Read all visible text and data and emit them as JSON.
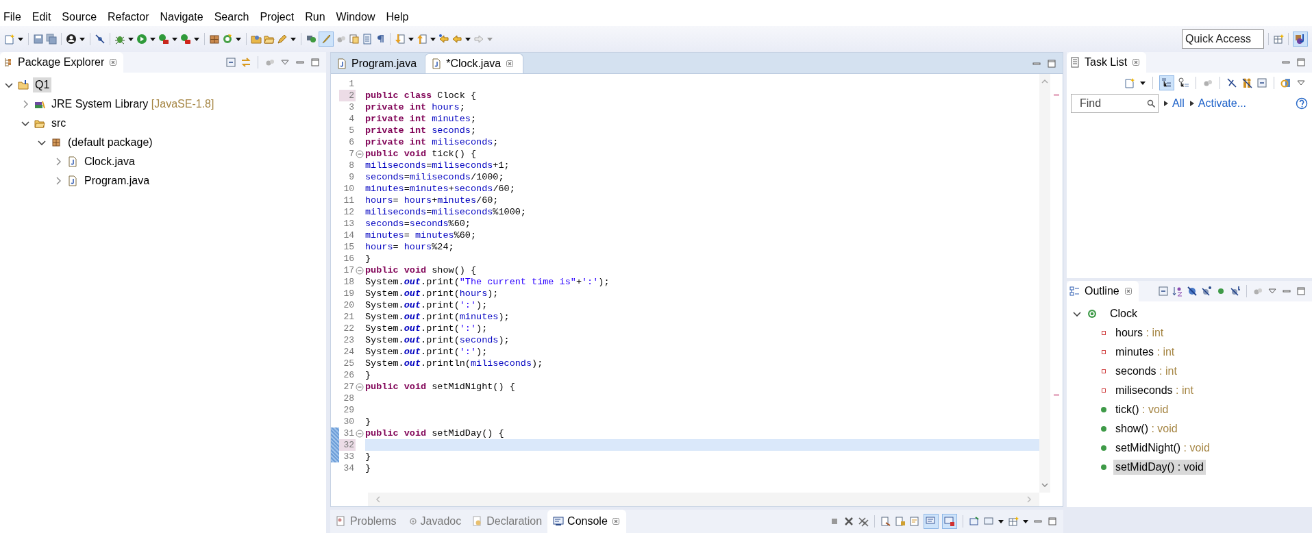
{
  "menu": [
    "File",
    "Edit",
    "Source",
    "Refactor",
    "Navigate",
    "Search",
    "Project",
    "Run",
    "Window",
    "Help"
  ],
  "toolbar": {
    "highlight_toggle": {
      "on": true
    },
    "quick_access": {
      "placeholder": "Quick Access"
    }
  },
  "package_explorer": {
    "title": "Package Explorer",
    "tree": [
      {
        "label": "Q1",
        "kind": "project",
        "expanded": true,
        "selected": true,
        "children": [
          {
            "label": "JRE System Library",
            "decoration": "[JavaSE-1.8]",
            "kind": "library",
            "expanded": false,
            "selected": false
          },
          {
            "label": "src",
            "kind": "folder",
            "expanded": true,
            "selected": false,
            "children": [
              {
                "label": "(default package)",
                "kind": "package",
                "expanded": true,
                "selected": false,
                "children": [
                  {
                    "label": "Clock.java",
                    "kind": "file",
                    "expanded": false,
                    "selected": false
                  },
                  {
                    "label": "Program.java",
                    "kind": "file",
                    "expanded": false,
                    "selected": false
                  }
                ]
              }
            ]
          }
        ]
      }
    ]
  },
  "editor": {
    "tabs": [
      {
        "label": "Program.java",
        "selected": false
      },
      {
        "label": "*Clock.java",
        "selected": true
      }
    ],
    "lines": [
      {
        "number": "1",
        "fold_marker": false,
        "changed": false,
        "current": false,
        "number_marked": false
      },
      {
        "number": "2",
        "fold_marker": false,
        "changed": false,
        "current": false,
        "number_marked": true,
        "tokens": [
          {
            "kind": "keyword",
            "text": "public class"
          },
          {
            "kind": "plain",
            "text": " Clock {"
          }
        ]
      },
      {
        "number": "3",
        "fold_marker": false,
        "changed": false,
        "current": false,
        "number_marked": false,
        "tokens": [
          {
            "kind": "keyword",
            "text": "private int "
          },
          {
            "kind": "field",
            "text": "hours"
          },
          {
            "kind": "plain",
            "text": ";"
          }
        ]
      },
      {
        "number": "4",
        "fold_marker": false,
        "changed": false,
        "current": false,
        "number_marked": false,
        "tokens": [
          {
            "kind": "keyword",
            "text": "private int "
          },
          {
            "kind": "field",
            "text": "minutes"
          },
          {
            "kind": "plain",
            "text": ";"
          }
        ]
      },
      {
        "number": "5",
        "fold_marker": false,
        "changed": false,
        "current": false,
        "number_marked": false,
        "tokens": [
          {
            "kind": "keyword",
            "text": "private int "
          },
          {
            "kind": "field",
            "text": "seconds"
          },
          {
            "kind": "plain",
            "text": ";"
          }
        ]
      },
      {
        "number": "6",
        "fold_marker": false,
        "changed": false,
        "current": false,
        "number_marked": false,
        "tokens": [
          {
            "kind": "keyword",
            "text": "private int "
          },
          {
            "kind": "field",
            "text": "miliseconds"
          },
          {
            "kind": "plain",
            "text": ";"
          }
        ]
      },
      {
        "number": "7",
        "fold_marker": true,
        "changed": false,
        "current": false,
        "number_marked": false,
        "tokens": [
          {
            "kind": "keyword",
            "text": "public void"
          },
          {
            "kind": "plain",
            "text": " tick() {"
          }
        ]
      },
      {
        "number": "8",
        "fold_marker": false,
        "changed": false,
        "current": false,
        "number_marked": false,
        "tokens": [
          {
            "kind": "field",
            "text": "miliseconds"
          },
          {
            "kind": "plain",
            "text": "="
          },
          {
            "kind": "field",
            "text": "miliseconds"
          },
          {
            "kind": "plain",
            "text": "+1;"
          }
        ]
      },
      {
        "number": "9",
        "fold_marker": false,
        "changed": false,
        "current": false,
        "number_marked": false,
        "tokens": [
          {
            "kind": "field",
            "text": "seconds"
          },
          {
            "kind": "plain",
            "text": "="
          },
          {
            "kind": "field",
            "text": "miliseconds"
          },
          {
            "kind": "plain",
            "text": "/1000;"
          }
        ]
      },
      {
        "number": "10",
        "fold_marker": false,
        "changed": false,
        "current": false,
        "number_marked": false,
        "tokens": [
          {
            "kind": "field",
            "text": "minutes"
          },
          {
            "kind": "plain",
            "text": "="
          },
          {
            "kind": "field",
            "text": "minutes"
          },
          {
            "kind": "plain",
            "text": "+"
          },
          {
            "kind": "field",
            "text": "seconds"
          },
          {
            "kind": "plain",
            "text": "/60;"
          }
        ]
      },
      {
        "number": "11",
        "fold_marker": false,
        "changed": false,
        "current": false,
        "number_marked": false,
        "tokens": [
          {
            "kind": "field",
            "text": "hours"
          },
          {
            "kind": "plain",
            "text": "= "
          },
          {
            "kind": "field",
            "text": "hours"
          },
          {
            "kind": "plain",
            "text": "+"
          },
          {
            "kind": "field",
            "text": "minutes"
          },
          {
            "kind": "plain",
            "text": "/60;"
          }
        ]
      },
      {
        "number": "12",
        "fold_marker": false,
        "changed": false,
        "current": false,
        "number_marked": false,
        "tokens": [
          {
            "kind": "field",
            "text": "miliseconds"
          },
          {
            "kind": "plain",
            "text": "="
          },
          {
            "kind": "field",
            "text": "miliseconds"
          },
          {
            "kind": "plain",
            "text": "%1000;"
          }
        ]
      },
      {
        "number": "13",
        "fold_marker": false,
        "changed": false,
        "current": false,
        "number_marked": false,
        "tokens": [
          {
            "kind": "field",
            "text": "seconds"
          },
          {
            "kind": "plain",
            "text": "="
          },
          {
            "kind": "field",
            "text": "seconds"
          },
          {
            "kind": "plain",
            "text": "%60;"
          }
        ]
      },
      {
        "number": "14",
        "fold_marker": false,
        "changed": false,
        "current": false,
        "number_marked": false,
        "tokens": [
          {
            "kind": "field",
            "text": "minutes"
          },
          {
            "kind": "plain",
            "text": "= "
          },
          {
            "kind": "field",
            "text": "minutes"
          },
          {
            "kind": "plain",
            "text": "%60;"
          }
        ]
      },
      {
        "number": "15",
        "fold_marker": false,
        "changed": false,
        "current": false,
        "number_marked": false,
        "tokens": [
          {
            "kind": "field",
            "text": "hours"
          },
          {
            "kind": "plain",
            "text": "= "
          },
          {
            "kind": "field",
            "text": "hours"
          },
          {
            "kind": "plain",
            "text": "%24;"
          }
        ]
      },
      {
        "number": "16",
        "fold_marker": false,
        "changed": false,
        "current": false,
        "number_marked": false,
        "tokens": [
          {
            "kind": "plain",
            "text": "}"
          }
        ]
      },
      {
        "number": "17",
        "fold_marker": true,
        "changed": false,
        "current": false,
        "number_marked": false,
        "tokens": [
          {
            "kind": "keyword",
            "text": "public void"
          },
          {
            "kind": "plain",
            "text": " show() {"
          }
        ]
      },
      {
        "number": "18",
        "fold_marker": false,
        "changed": false,
        "current": false,
        "number_marked": false,
        "tokens": [
          {
            "kind": "plain",
            "text": "System."
          },
          {
            "kind": "static",
            "text": "out"
          },
          {
            "kind": "plain",
            "text": ".print("
          },
          {
            "kind": "string",
            "text": "\"The current time is\""
          },
          {
            "kind": "plain",
            "text": "+"
          },
          {
            "kind": "string",
            "text": "':'"
          },
          {
            "kind": "plain",
            "text": ");"
          }
        ]
      },
      {
        "number": "19",
        "fold_marker": false,
        "changed": false,
        "current": false,
        "number_marked": false,
        "tokens": [
          {
            "kind": "plain",
            "text": "System."
          },
          {
            "kind": "static",
            "text": "out"
          },
          {
            "kind": "plain",
            "text": ".print("
          },
          {
            "kind": "field",
            "text": "hours"
          },
          {
            "kind": "plain",
            "text": ");"
          }
        ]
      },
      {
        "number": "20",
        "fold_marker": false,
        "changed": false,
        "current": false,
        "number_marked": false,
        "tokens": [
          {
            "kind": "plain",
            "text": "System."
          },
          {
            "kind": "static",
            "text": "out"
          },
          {
            "kind": "plain",
            "text": ".print("
          },
          {
            "kind": "string",
            "text": "':'"
          },
          {
            "kind": "plain",
            "text": ");"
          }
        ]
      },
      {
        "number": "21",
        "fold_marker": false,
        "changed": false,
        "current": false,
        "number_marked": false,
        "tokens": [
          {
            "kind": "plain",
            "text": "System."
          },
          {
            "kind": "static",
            "text": "out"
          },
          {
            "kind": "plain",
            "text": ".print("
          },
          {
            "kind": "field",
            "text": "minutes"
          },
          {
            "kind": "plain",
            "text": ");"
          }
        ]
      },
      {
        "number": "22",
        "fold_marker": false,
        "changed": false,
        "current": false,
        "number_marked": false,
        "tokens": [
          {
            "kind": "plain",
            "text": "System."
          },
          {
            "kind": "static",
            "text": "out"
          },
          {
            "kind": "plain",
            "text": ".print("
          },
          {
            "kind": "string",
            "text": "':'"
          },
          {
            "kind": "plain",
            "text": ");"
          }
        ]
      },
      {
        "number": "23",
        "fold_marker": false,
        "changed": false,
        "current": false,
        "number_marked": false,
        "tokens": [
          {
            "kind": "plain",
            "text": "System."
          },
          {
            "kind": "static",
            "text": "out"
          },
          {
            "kind": "plain",
            "text": ".print("
          },
          {
            "kind": "field",
            "text": "seconds"
          },
          {
            "kind": "plain",
            "text": ");"
          }
        ]
      },
      {
        "number": "24",
        "fold_marker": false,
        "changed": false,
        "current": false,
        "number_marked": false,
        "tokens": [
          {
            "kind": "plain",
            "text": "System."
          },
          {
            "kind": "static",
            "text": "out"
          },
          {
            "kind": "plain",
            "text": ".print("
          },
          {
            "kind": "string",
            "text": "':'"
          },
          {
            "kind": "plain",
            "text": ");"
          }
        ]
      },
      {
        "number": "25",
        "fold_marker": false,
        "changed": false,
        "current": false,
        "number_marked": false,
        "tokens": [
          {
            "kind": "plain",
            "text": "System."
          },
          {
            "kind": "static",
            "text": "out"
          },
          {
            "kind": "plain",
            "text": ".println("
          },
          {
            "kind": "field",
            "text": "miliseconds"
          },
          {
            "kind": "plain",
            "text": ");"
          }
        ]
      },
      {
        "number": "26",
        "fold_marker": false,
        "changed": false,
        "current": false,
        "number_marked": false,
        "tokens": [
          {
            "kind": "plain",
            "text": "}"
          }
        ]
      },
      {
        "number": "27",
        "fold_marker": true,
        "changed": false,
        "current": false,
        "number_marked": false,
        "tokens": [
          {
            "kind": "keyword",
            "text": "public void"
          },
          {
            "kind": "plain",
            "text": " setMidNight() {"
          }
        ]
      },
      {
        "number": "28",
        "fold_marker": false,
        "changed": false,
        "current": false,
        "number_marked": false
      },
      {
        "number": "29",
        "fold_marker": false,
        "changed": false,
        "current": false,
        "number_marked": false
      },
      {
        "number": "30",
        "fold_marker": false,
        "changed": false,
        "current": false,
        "number_marked": false,
        "tokens": [
          {
            "kind": "plain",
            "text": "}"
          }
        ]
      },
      {
        "number": "31",
        "fold_marker": true,
        "changed": true,
        "current": false,
        "number_marked": false,
        "tokens": [
          {
            "kind": "keyword",
            "text": "public void"
          },
          {
            "kind": "plain",
            "text": " setMidDay() {"
          }
        ]
      },
      {
        "number": "32",
        "fold_marker": false,
        "changed": true,
        "current": true,
        "number_marked": true
      },
      {
        "number": "33",
        "fold_marker": false,
        "changed": true,
        "current": false,
        "number_marked": false,
        "tokens": [
          {
            "kind": "plain",
            "text": "}"
          }
        ]
      },
      {
        "number": "34",
        "fold_marker": false,
        "changed": false,
        "current": false,
        "number_marked": false,
        "tokens": [
          {
            "kind": "plain",
            "text": "}"
          }
        ]
      }
    ]
  },
  "task_list": {
    "title": "Task List",
    "toolbar_toggle": {
      "on": true
    },
    "find": {
      "placeholder": "Find"
    },
    "links": [
      "All",
      "Activate..."
    ]
  },
  "outline": {
    "title": "Outline",
    "tree": [
      {
        "name": "Clock",
        "kind": "class",
        "expanded": true,
        "selected": false,
        "children": [
          {
            "name": "hours",
            "type": ": int",
            "kind": "field",
            "selected": false
          },
          {
            "name": "minutes",
            "type": ": int",
            "kind": "field",
            "selected": false
          },
          {
            "name": "seconds",
            "type": ": int",
            "kind": "field",
            "selected": false
          },
          {
            "name": "miliseconds",
            "type": ": int",
            "kind": "field",
            "selected": false
          },
          {
            "name": "tick()",
            "type": ": void",
            "kind": "method",
            "selected": false
          },
          {
            "name": "show()",
            "type": ": void",
            "kind": "method",
            "selected": false
          },
          {
            "name": "setMidNight()",
            "type": ": void",
            "kind": "method",
            "selected": false
          },
          {
            "name": "setMidDay()",
            "type": ": void",
            "kind": "method",
            "selected": true
          }
        ]
      }
    ]
  },
  "bottom_panel": {
    "tabs": [
      {
        "label": "Problems",
        "kind": "problems",
        "selected": false
      },
      {
        "label": "Javadoc",
        "kind": "javadoc",
        "selected": false
      },
      {
        "label": "Declaration",
        "kind": "declaration",
        "selected": false
      },
      {
        "label": "Console",
        "kind": "console",
        "selected": true
      }
    ],
    "toolbar_toggles": [
      {
        "on": true
      },
      {
        "on": true
      }
    ]
  }
}
